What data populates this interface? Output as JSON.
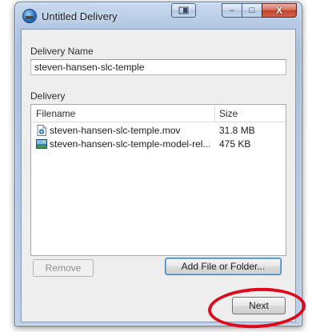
{
  "window": {
    "title": "Untitled Delivery"
  },
  "caption_buttons": {
    "minimize_glyph": "–",
    "maximize_glyph": "□",
    "close_glyph": "X"
  },
  "delivery_name": {
    "label": "Delivery Name",
    "value": "steven-hansen-slc-temple"
  },
  "delivery": {
    "label": "Delivery",
    "columns": {
      "filename": "Filename",
      "size": "Size"
    },
    "files": [
      {
        "name": "steven-hansen-slc-temple.mov",
        "size": "31.8 MB",
        "icon": "movie-file-icon"
      },
      {
        "name": "steven-hansen-slc-temple-model-rel...",
        "size": "475 KB",
        "icon": "image-file-icon"
      }
    ]
  },
  "buttons": {
    "remove": "Remove",
    "add": "Add File or Folder...",
    "next": "Next"
  },
  "annotation": {
    "color": "#e0081b"
  }
}
